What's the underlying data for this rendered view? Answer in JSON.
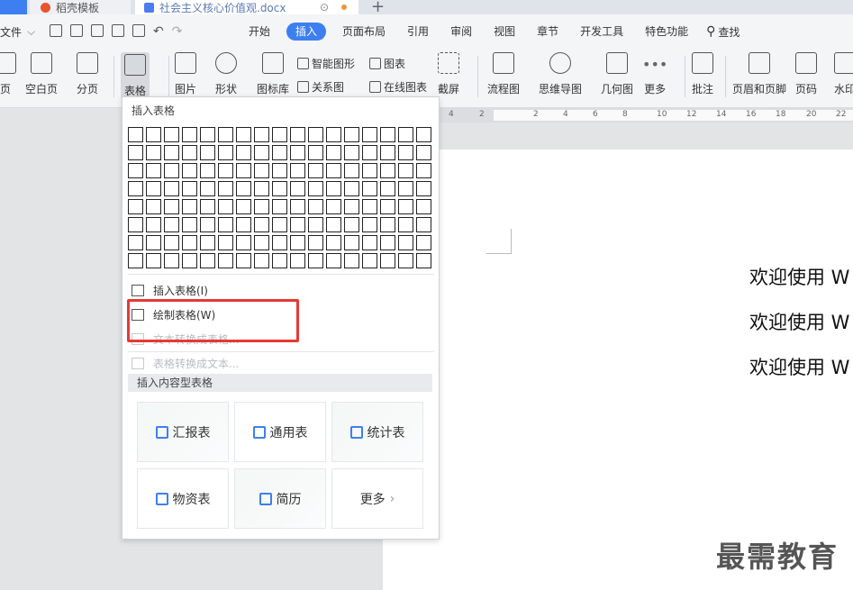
{
  "tabs": {
    "template": "稻壳模板",
    "document": "社会主义核心价值观.docx"
  },
  "menu": {
    "file": "文件",
    "tabs": [
      "开始",
      "插入",
      "页面布局",
      "引用",
      "审阅",
      "视图",
      "章节",
      "开发工具",
      "特色功能"
    ],
    "active_tab": "插入",
    "search": "查找"
  },
  "ribbon": {
    "page": "页",
    "blank_page": "空白页",
    "page_break": "分页",
    "table": "表格",
    "picture": "图片",
    "shape": "形状",
    "icon_lib": "图标库",
    "smart_shape": "智能图形",
    "chart": "图表",
    "relation": "关系图",
    "online_chart": "在线图表",
    "screenshot": "截屏",
    "flowchart": "流程图",
    "mindmap": "思维导图",
    "geometry": "几何图",
    "more": "更多",
    "comment": "批注",
    "header_footer": "页眉和页脚",
    "page_number": "页码",
    "watermark": "水印"
  },
  "ruler": {
    "marks": [
      "4",
      "2",
      "2",
      "4",
      "6",
      "8",
      "10",
      "12",
      "14",
      "16",
      "18",
      "20",
      "22"
    ]
  },
  "dropdown": {
    "title": "插入表格",
    "grid_rows": 8,
    "grid_cols": 17,
    "items": [
      {
        "label": "插入表格(I)",
        "enabled": true
      },
      {
        "label": "绘制表格(W)",
        "enabled": true
      },
      {
        "label": "文本转换成表格...",
        "enabled": false
      },
      {
        "label": "表格转换成文本...",
        "enabled": false
      }
    ],
    "section": "插入内容型表格",
    "cards": [
      "汇报表",
      "通用表",
      "统计表",
      "物资表",
      "简历",
      "更多"
    ]
  },
  "document": {
    "lines": [
      "欢迎使用 W",
      "欢迎使用 W",
      "欢迎使用 W"
    ],
    "watermark_text": "最需教育"
  }
}
